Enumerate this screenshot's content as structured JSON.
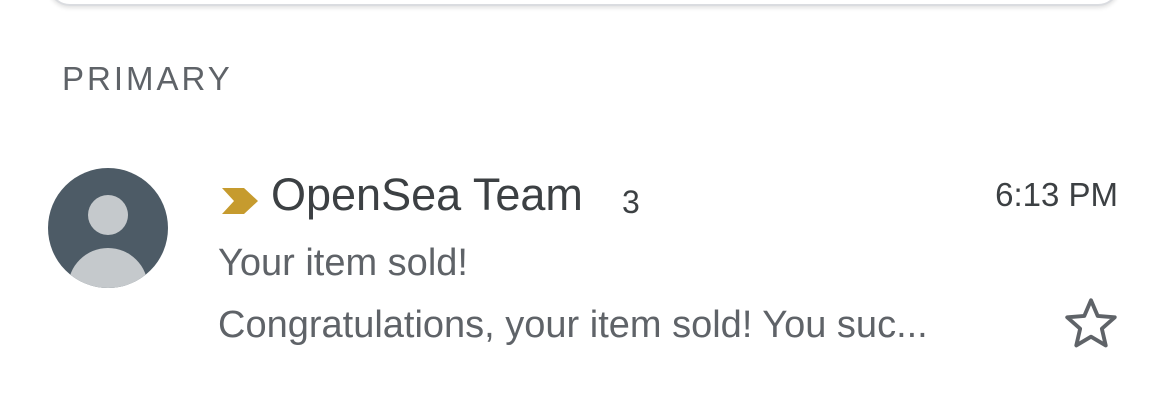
{
  "section": {
    "label": "PRIMARY"
  },
  "email": {
    "sender": "OpenSea Team",
    "thread_count": "3",
    "time": "6:13 PM",
    "subject": "Your item sold!",
    "snippet": "Congratulations, your item sold! You suc...",
    "importance_color": "#c69b2e",
    "avatar_bg": "#4d5b66",
    "avatar_fg": "#c5c9cc"
  },
  "icons": {
    "importance": "importance-marker-icon",
    "star": "star-outline-icon",
    "avatar": "person-avatar-icon"
  }
}
